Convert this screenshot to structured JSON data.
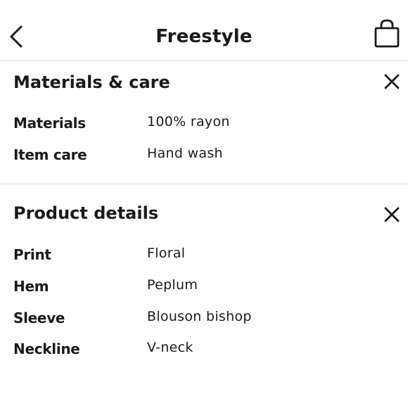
{
  "header": {
    "title": "Freestyle",
    "back_icon": "chevron-left-icon",
    "bag_icon": "shopping-bag-icon"
  },
  "materials_section": {
    "title": "Materials & care",
    "close_icon": "close-icon",
    "rows": [
      {
        "label": "Materials",
        "value": "100% rayon"
      },
      {
        "label": "Item care",
        "value": "Hand wash"
      }
    ]
  },
  "details_section": {
    "title": "Product details",
    "close_icon": "close-icon",
    "rows": [
      {
        "label": "Print",
        "value": "Floral"
      },
      {
        "label": "Hem",
        "value": "Peplum"
      },
      {
        "label": "Sleeve",
        "value": "Blouson bishop"
      },
      {
        "label": "Neckline",
        "value": "V-neck"
      }
    ]
  },
  "colors": {
    "text": "#1a1a1a",
    "divider": "#d6d6d6",
    "background": "#ffffff"
  }
}
